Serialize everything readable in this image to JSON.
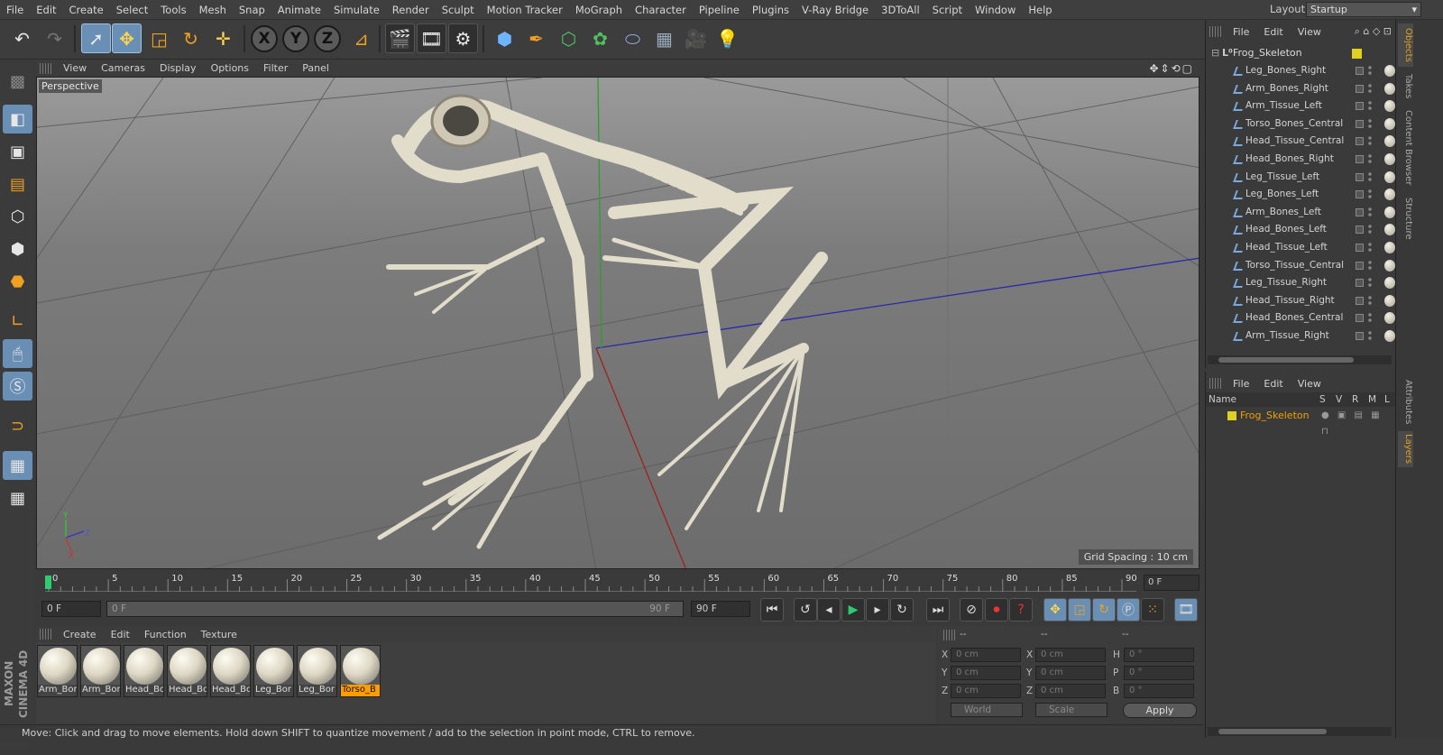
{
  "menu": [
    "File",
    "Edit",
    "Create",
    "Select",
    "Tools",
    "Mesh",
    "Snap",
    "Animate",
    "Simulate",
    "Render",
    "Sculpt",
    "Motion Tracker",
    "MoGraph",
    "Character",
    "Pipeline",
    "Plugins",
    "V-Ray Bridge",
    "3DToAll",
    "Script",
    "Window",
    "Help"
  ],
  "layout": {
    "label": "Layout:",
    "value": "Startup"
  },
  "viewport": {
    "menu": [
      "View",
      "Cameras",
      "Display",
      "Options",
      "Filter",
      "Panel"
    ],
    "camera": "Perspective",
    "grid_spacing": "Grid Spacing : 10 cm"
  },
  "timeline": {
    "ticks": [
      "0",
      "5",
      "10",
      "15",
      "20",
      "25",
      "30",
      "35",
      "40",
      "45",
      "50",
      "55",
      "60",
      "65",
      "70",
      "75",
      "80",
      "85",
      "90"
    ],
    "frame_box": "0 F"
  },
  "transport": {
    "current": "0 F",
    "range_start": "0 F",
    "range_end_inner": "90 F",
    "range_end": "90 F"
  },
  "materials": {
    "menu": [
      "Create",
      "Edit",
      "Function",
      "Texture"
    ],
    "items": [
      "Arm_Bor",
      "Arm_Bor",
      "Head_Bo",
      "Head_Bo",
      "Head_Bo",
      "Leg_Bor",
      "Leg_Bor",
      "Torso_B"
    ],
    "selected_index": 7
  },
  "coords": {
    "header": [
      "--",
      "--",
      "--"
    ],
    "rows": [
      [
        "X",
        "0 cm",
        "X",
        "0 cm",
        "H",
        "0 °"
      ],
      [
        "Y",
        "0 cm",
        "Y",
        "0 cm",
        "P",
        "0 °"
      ],
      [
        "Z",
        "0 cm",
        "Z",
        "0 cm",
        "B",
        "0 °"
      ]
    ],
    "mode": "World",
    "scale": "Scale",
    "apply": "Apply"
  },
  "status": "Move: Click and drag to move elements. Hold down SHIFT to quantize movement / add to the selection in point mode, CTRL to remove.",
  "brand": "MAXON CINEMA 4D",
  "objects": {
    "menu": [
      "File",
      "Edit",
      "View"
    ],
    "root": "Frog_Skeleton",
    "items": [
      "Leg_Bones_Right",
      "Arm_Bones_Right",
      "Arm_Tissue_Left",
      "Torso_Bones_Central",
      "Head_Tissue_Central",
      "Head_Bones_Right",
      "Leg_Tissue_Left",
      "Leg_Bones_Left",
      "Arm_Bones_Left",
      "Head_Bones_Left",
      "Head_Tissue_Left",
      "Torso_Tissue_Central",
      "Leg_Tissue_Right",
      "Head_Tissue_Right",
      "Head_Bones_Central",
      "Arm_Tissue_Right"
    ]
  },
  "layers": {
    "menu": [
      "File",
      "Edit",
      "View"
    ],
    "columns": "Name",
    "flags": [
      "S",
      "V",
      "R",
      "M",
      "L"
    ],
    "row": "Frog_Skeleton"
  },
  "right_tabs": [
    "Objects",
    "Takes",
    "Content Browser",
    "Structure",
    "Attributes",
    "Layers"
  ],
  "colors": {
    "accent": "#6a8fb5",
    "selection": "#ff9c00",
    "layer": "#f0a000"
  }
}
